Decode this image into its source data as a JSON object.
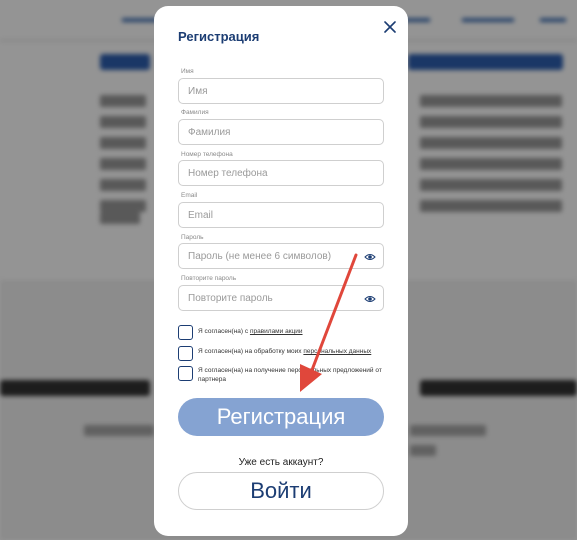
{
  "colors": {
    "brand_dark": "#1c3d73",
    "button_primary": "#85a3d2",
    "arrow_red": "#e0473b"
  },
  "modal": {
    "title": "Регистрация",
    "close_icon": "close-icon",
    "fields": [
      {
        "label": "Имя",
        "placeholder": "Имя"
      },
      {
        "label": "Фамилия",
        "placeholder": "Фамилия"
      },
      {
        "label": "Номер телефона",
        "placeholder": "Номер телефона"
      },
      {
        "label": "Email",
        "placeholder": "Email"
      },
      {
        "label": "Пароль",
        "placeholder": "Пароль (не менее 6 символов)",
        "icon": "eye-icon"
      },
      {
        "label": "Повторите пароль",
        "placeholder": "Повторите пароль",
        "icon": "eye-icon"
      }
    ],
    "consents": [
      {
        "prefix": "Я согласен(на) с ",
        "link": "правилами акции"
      },
      {
        "prefix": "Я согласен(на) на обработку моих ",
        "link": "персональных данных"
      },
      {
        "text": "Я согласен(на) на получение персональных предложений от партнера"
      }
    ],
    "register_button": "Регистрация",
    "have_account": "Уже есть аккаунт?",
    "login_button": "Войти"
  }
}
